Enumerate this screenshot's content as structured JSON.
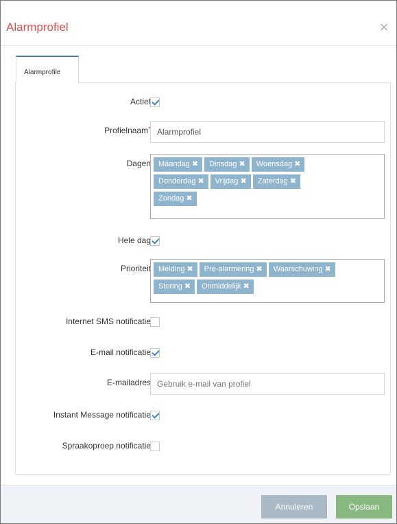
{
  "dialog": {
    "title": "Alarmprofiel",
    "close_glyph": "×"
  },
  "tabs": [
    {
      "label": "Alarmprofile",
      "active": true
    }
  ],
  "form": {
    "actief": {
      "label": "Actief",
      "checked": true
    },
    "profielnaam": {
      "label": "Profielnaam",
      "required_mark": "*",
      "value": "Alarmprofiel"
    },
    "dagen": {
      "label": "Dagen",
      "tags": [
        "Maandag",
        "Dinsdag",
        "Woensdag",
        "Donderdag",
        "Vrijdag",
        "Zaterdag",
        "Zondag"
      ]
    },
    "hele_dag": {
      "label": "Hele dag",
      "checked": true
    },
    "prioriteit": {
      "label": "Prioriteit",
      "tags": [
        "Melding",
        "Pre-alarmering",
        "Waarschuwing",
        "Storing",
        "Onmiddelijk"
      ]
    },
    "internet_sms": {
      "label": "Internet SMS notificatie",
      "checked": false
    },
    "email_notificatie": {
      "label": "E-mail notificatie",
      "checked": true
    },
    "emailadres": {
      "label": "E-mailadres",
      "placeholder": "Gebruik e-mail van profiel"
    },
    "instant_message": {
      "label": "Instant Message notificatie",
      "checked": true
    },
    "spraakoproep": {
      "label": "Spraakoproep notificatie",
      "checked": false
    }
  },
  "tag_remove_glyph": "✖",
  "footer": {
    "cancel_label": "Annuleren",
    "save_label": "Opslaan"
  },
  "colors": {
    "title": "#d9534f",
    "tag_bg": "#8fb4cd",
    "save_bg": "#87b87f",
    "cancel_bg": "#a9bac6",
    "tab_accent": "#3d7ab8",
    "checkmark": "#3a84c5"
  }
}
